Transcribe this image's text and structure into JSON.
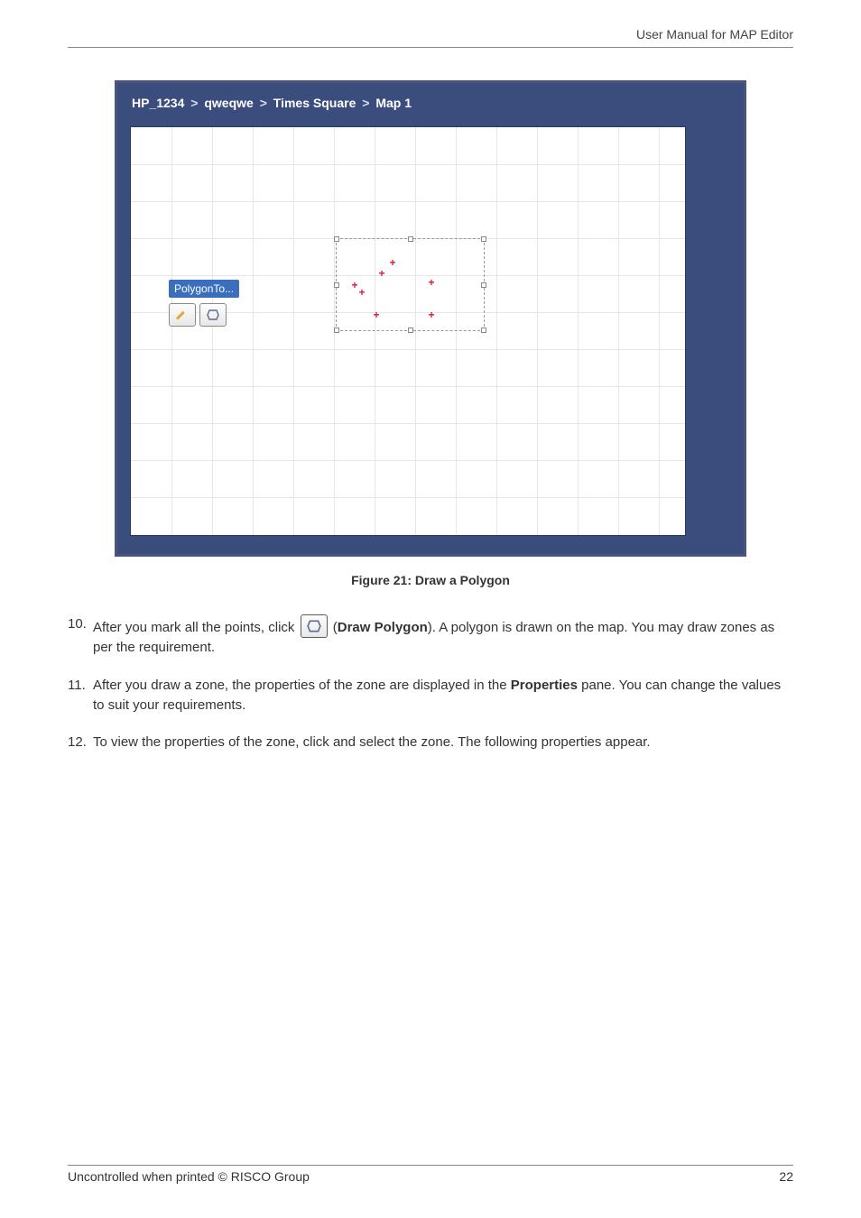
{
  "header": {
    "right": "User Manual for MAP Editor"
  },
  "screenshot": {
    "breadcrumb": {
      "parts": [
        "HP_1234",
        "qweqwe",
        "Times Square",
        "Map 1"
      ],
      "sep": ">"
    },
    "tooltip_label": "PolygonTo..."
  },
  "figure_caption": "Figure 21: Draw a Polygon",
  "steps": [
    {
      "num": "10.",
      "pre": "After you mark all the points, click ",
      "btn_name": "Draw Polygon",
      "post": "). A polygon is drawn on the map. You may draw zones as per the requirement."
    },
    {
      "num": "11.",
      "text_pre": "After you draw a zone, the properties of the zone are displayed in the ",
      "bold": "Properties",
      "text_post": " pane. You can change the values to suit your requirements."
    },
    {
      "num": "12.",
      "text": "To view the properties of the zone, click and select the zone. The following properties appear."
    }
  ],
  "footer": {
    "left": "Uncontrolled when printed © RISCO Group",
    "right": "22"
  }
}
